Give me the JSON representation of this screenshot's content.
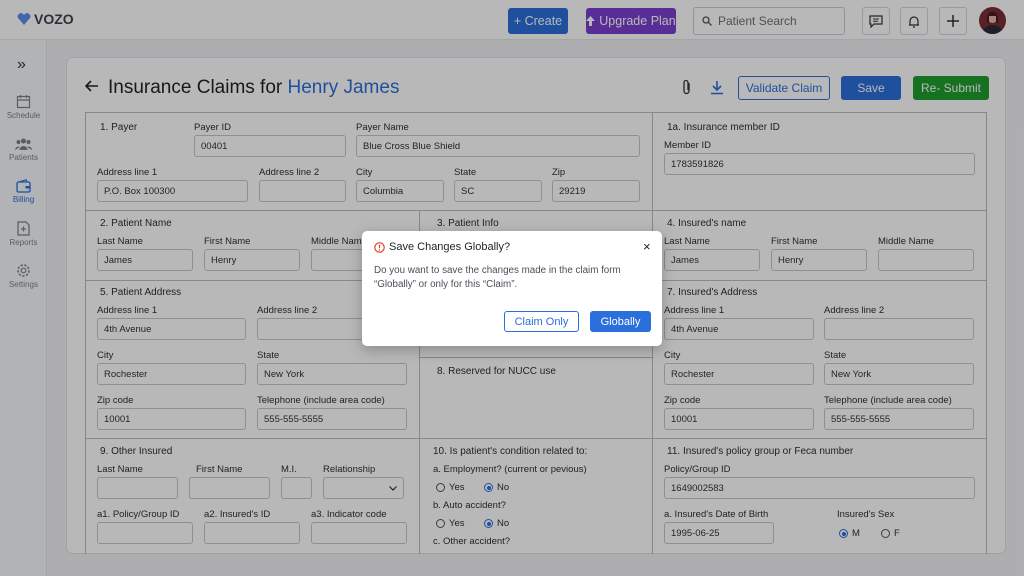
{
  "brand": {
    "name": "VOZO",
    "color": "#2a6fdb"
  },
  "topbar": {
    "create_label": "+ Create",
    "upgrade_label": "Upgrade Plan",
    "search_placeholder": "Patient Search"
  },
  "sidebar": {
    "toggle": "»",
    "items": [
      {
        "label": "Schedule",
        "icon": "calendar-icon"
      },
      {
        "label": "Patients",
        "icon": "users-icon"
      },
      {
        "label": "Billing",
        "icon": "wallet-icon",
        "active": true
      },
      {
        "label": "Reports",
        "icon": "report-icon"
      },
      {
        "label": "Settings",
        "icon": "gear-icon"
      }
    ]
  },
  "page": {
    "title_prefix": "Insurance Claims for ",
    "patient_name": "Henry James",
    "validate_label": "Validate Claim",
    "save_label": "Save",
    "resubmit_label": "Re- Submit"
  },
  "form": {
    "payer": {
      "section": "1. Payer",
      "payer_id_label": "Payer ID",
      "payer_id": "00401",
      "payer_name_label": "Payer Name",
      "payer_name": "Blue Cross Blue Shield",
      "addr1_label": "Address line 1",
      "addr1": "P.O. Box 100300",
      "addr2_label": "Address line 2",
      "city_label": "City",
      "city": "Columbia",
      "state_label": "State",
      "state": "SC",
      "zip_label": "Zip",
      "zip": "29219"
    },
    "member": {
      "section": "1a. Insurance member ID",
      "member_id_label": "Member ID",
      "member_id": "1783591826"
    },
    "patient_name": {
      "section": "2. Patient Name",
      "last_label": "Last Name",
      "last": "James",
      "first_label": "First Name",
      "first": "Henry",
      "middle_label": "Middle Nam"
    },
    "patient_info": {
      "section": "3. Patient Info"
    },
    "insured_name": {
      "section": "4. Insured's name",
      "last_label": "Last Name",
      "last": "James",
      "first_label": "First Name",
      "first": "Henry",
      "middle_label": "Middle Name"
    },
    "patient_address": {
      "section": "5. Patient Address",
      "addr1_label": "Address line 1",
      "addr1": "4th Avenue",
      "addr2_label": "Address line 2",
      "city_label": "City",
      "city": "Rochester",
      "state_label": "State",
      "state": "New York",
      "zip_label": "Zip code",
      "zip": "10001",
      "phone_label": "Telephone (include area code)",
      "phone": "555-555-5555"
    },
    "nucc": {
      "section": "8. Reserved for NUCC use"
    },
    "insured_address": {
      "section": "7. Insured's Address",
      "addr1_label": "Address line 1",
      "addr1": "4th Avenue",
      "addr2_label": "Address line 2",
      "city_label": "City",
      "city": "Rochester",
      "state_label": "State",
      "state": "New York",
      "zip_label": "Zip code",
      "zip": "10001",
      "phone_label": "Telephone (include area code)",
      "phone": "555-555-5555"
    },
    "other_insured": {
      "section": "9. Other Insured",
      "last_label": "Last Name",
      "first_label": "First Name",
      "mi_label": "M.I.",
      "rel_label": "Relationship",
      "policy_label": "a1. Policy/Group ID",
      "insured_id_label": "a2. Insured's ID",
      "indicator_label": "a3. Indicator code"
    },
    "condition": {
      "section": "10. Is patient's condition related to:",
      "employment": "a. Employment? (current or pevious)",
      "auto": "b. Auto accident?",
      "other": "c. Other accident?",
      "yes": "Yes",
      "no": "No"
    },
    "policy": {
      "section": "11. Insured's policy group or Feca number",
      "policy_label": "Policy/Group ID",
      "policy": "1649002583",
      "dob_label": "a. Insured's Date of Birth",
      "dob": "1995-06-25",
      "sex_label": "Insured's Sex",
      "male": "M",
      "female": "F"
    }
  },
  "modal": {
    "title": "Save Changes Globally?",
    "body": "Do you want to save the changes made in the claim form “Globally” or only for this “Claim”.",
    "claim_only_label": "Claim Only",
    "globally_label": "Globally",
    "close": "×"
  }
}
